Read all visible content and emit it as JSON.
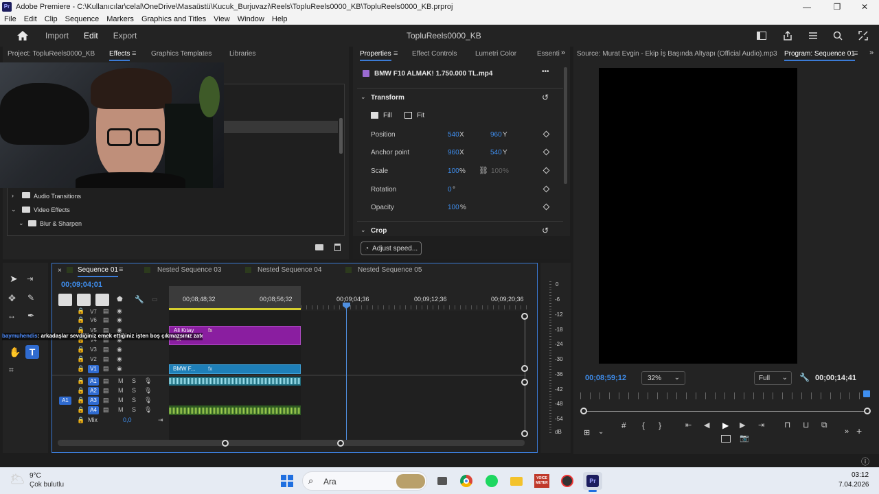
{
  "window": {
    "title": "Adobe Premiere - C:\\Kullanıcılar\\celal\\OneDrive\\Masaüstü\\Kucuk_Burjuvazi\\Reels\\TopluReels0000_KB\\TopluReels0000_KB.prproj",
    "app_icon": "Pr",
    "minimize": "—",
    "maximize": "❐",
    "close": "✕"
  },
  "menu": [
    "File",
    "Edit",
    "Clip",
    "Sequence",
    "Markers",
    "Graphics and Titles",
    "View",
    "Window",
    "Help"
  ],
  "header": {
    "nav": [
      "Import",
      "Edit",
      "Export"
    ],
    "active": "Edit",
    "project_title": "TopluReels0000_KB",
    "icons": [
      "home-icon",
      "panels-icon",
      "share-icon",
      "lines-icon",
      "search-icon",
      "fullscreen-icon"
    ]
  },
  "left_panel": {
    "tabs": [
      "Project: TopluReels0000_KB",
      "Effects",
      "Graphics Templates",
      "Libraries"
    ],
    "active": "Effects",
    "tree": [
      {
        "label": "Audio Transitions",
        "expanded": false
      },
      {
        "label": "Video Effects",
        "expanded": true
      },
      {
        "label": "Blur & Sharpen",
        "expanded": true
      }
    ]
  },
  "properties": {
    "tabs": [
      "Properties",
      "Effect Controls",
      "Lumetri Color",
      "Essenti"
    ],
    "active": "Properties",
    "clip_name": "BMW F10 ALMAK! 1.750.000 TL.mp4",
    "more": "•••",
    "transform": {
      "title": "Transform",
      "fill": "Fill",
      "fit": "Fit",
      "rows": [
        {
          "label": "Position",
          "v1": "540",
          "u1": "X",
          "v2": "960",
          "u2": "Y"
        },
        {
          "label": "Anchor point",
          "v1": "960",
          "u1": "X",
          "v2": "540",
          "u2": "Y"
        },
        {
          "label": "Scale",
          "v1": "100",
          "u1": "%",
          "v2": "100",
          "u2": "%"
        },
        {
          "label": "Rotation",
          "v1": "0",
          "u1": "°",
          "v2": "",
          "u2": ""
        },
        {
          "label": "Opacity",
          "v1": "100",
          "u1": "%",
          "v2": "",
          "u2": ""
        }
      ]
    },
    "crop": "Crop",
    "adjust_speed": "Adjust speed..."
  },
  "source": {
    "label": "Source: Murat Evgin - Ekip İş Başında  Altyapı (Official Audio).mp3",
    "program": "Program: Sequence 01"
  },
  "program": {
    "timecode_left": "00;08;59;12",
    "zoom": "32%",
    "quality": "Full",
    "timecode_right": "00;00;14;41"
  },
  "timeline": {
    "tabs": [
      "Sequence 01",
      "Nested Sequence 03",
      "Nested Sequence 04",
      "Nested Sequence 05"
    ],
    "active": "Sequence 01",
    "close": "×",
    "timecode": "00;09;04;01",
    "ruler": [
      "00;08;48;32",
      "00;08;56;32",
      "00;09;04;36",
      "00;09;12;36",
      "00;09;20;36"
    ],
    "video_tracks": [
      "V7",
      "V6",
      "V5",
      "V4",
      "V3",
      "V2",
      "V1"
    ],
    "audio_tracks": [
      "A1",
      "A2",
      "A3",
      "A4"
    ],
    "mix": "Mix",
    "mix_value": "0,0",
    "source_patch": "A1",
    "clips": {
      "purple": "Ali Kıtay",
      "fx": "fx",
      "v1": "BMW F...",
      "overlay_text_user": "baymuhendis",
      "overlay_text": ": arkadaşlar sevdiğiniz emek ettiğiniz işten boş çıkmazsınız zaten"
    },
    "meter": [
      "0",
      "-6",
      "-12",
      "-18",
      "-24",
      "-30",
      "-36",
      "-42",
      "-48",
      "-54",
      "dB"
    ]
  },
  "taskbar": {
    "weather_temp": "9°C",
    "weather_text": "Çok bulutlu",
    "search": "Ara",
    "time": "03:12",
    "date": "7.04.2026",
    "voicemeeter": "VOICE METER",
    "premiere": "Pr"
  }
}
